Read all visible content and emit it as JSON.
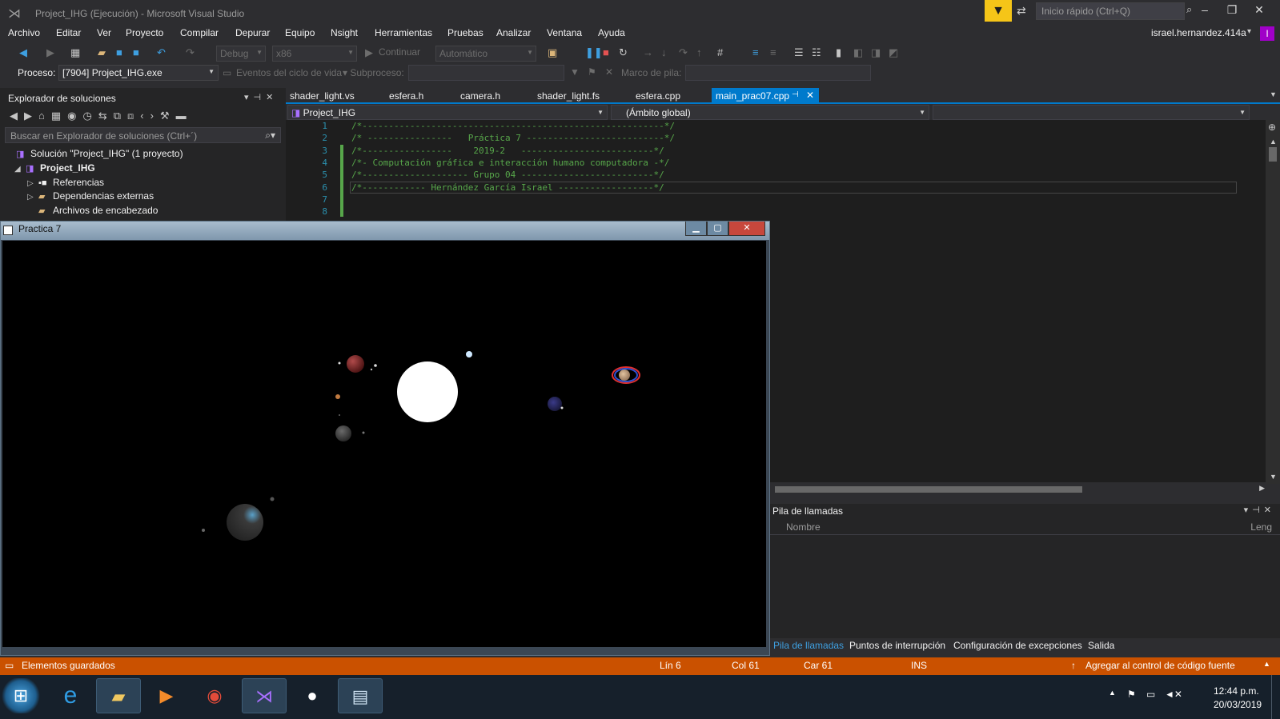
{
  "window": {
    "title": "Project_IHG (Ejecución) - Microsoft Visual Studio",
    "quick_launch_placeholder": "Inicio rápido (Ctrl+Q)",
    "user": "israel.hernandez.414a",
    "user_badge": "I"
  },
  "menu": [
    "Archivo",
    "Editar",
    "Ver",
    "Proyecto",
    "Compilar",
    "Depurar",
    "Equipo",
    "Nsight",
    "Herramientas",
    "Pruebas",
    "Analizar",
    "Ventana",
    "Ayuda"
  ],
  "toolbar": {
    "config": "Debug",
    "platform": "x86",
    "continue_label": "Continuar",
    "auto_label": "Automático"
  },
  "debug_location": {
    "process_label": "Proceso:",
    "process_value": "[7904] Project_IHG.exe",
    "lifecycle_label": "Eventos del ciclo de vida",
    "thread_label": "Subproceso:",
    "stack_label": "Marco de pila:"
  },
  "solution_explorer": {
    "title": "Explorador de soluciones",
    "search_placeholder": "Buscar en Explorador de soluciones (Ctrl+´)",
    "items": [
      {
        "label": "Solución \"Project_IHG\"  (1 proyecto)"
      },
      {
        "label": "Project_IHG"
      },
      {
        "label": "Referencias"
      },
      {
        "label": "Dependencias externas"
      },
      {
        "label": "Archivos de encabezado"
      }
    ]
  },
  "tabs": [
    "shader_light.vs",
    "esfera.h",
    "camera.h",
    "shader_light.fs",
    "esfera.cpp",
    "main_prac07.cpp"
  ],
  "navbar": {
    "project": "Project_IHG",
    "scope": "(Ámbito global)"
  },
  "code": {
    "lines": [
      {
        "n": "1",
        "text": "/*---------------------------------------------------------*/"
      },
      {
        "n": "2",
        "text": "/* ----------------   Práctica 7 --------------------------*/"
      },
      {
        "n": "3",
        "text": "/*-----------------    2019-2   -------------------------*/"
      },
      {
        "n": "4",
        "text": "/*- Computación gráfica e interacción humano computadora -*/"
      },
      {
        "n": "5",
        "text": "/*-------------------- Grupo 04 -------------------------*/"
      },
      {
        "n": "6",
        "text": "/*------------ Hernández García Israel ------------------*/"
      },
      {
        "n": "7",
        "text": ""
      },
      {
        "n": "8",
        "text": ""
      }
    ]
  },
  "gl_window": {
    "title": "Practica 7"
  },
  "callstack": {
    "title": "Pila de llamadas",
    "col_name": "Nombre",
    "col_lang": "Leng"
  },
  "bottom_tabs": [
    "Pila de llamadas",
    "Puntos de interrupción",
    "Configuración de excepciones",
    "Salida"
  ],
  "statusbar": {
    "message": "Elementos guardados",
    "line": "Lín 6",
    "col": "Col 61",
    "char": "Car 61",
    "mode": "INS",
    "source_control": "Agregar al control de código fuente"
  },
  "taskbar": {
    "time": "12:44 p.m.",
    "date": "20/03/2019"
  },
  "colors": {
    "accent": "#007acc",
    "status": "#ca5100",
    "comment": "#57a64a"
  }
}
